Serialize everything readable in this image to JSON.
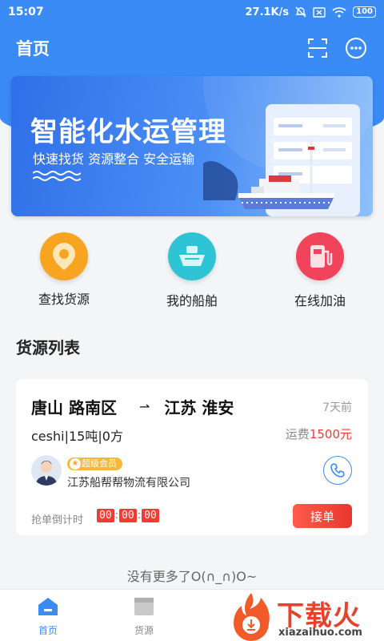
{
  "status_bar": {
    "time": "15:07",
    "network_speed": "27.1K/s",
    "battery": "100"
  },
  "header": {
    "title": "首页",
    "scan_icon": "scan-icon",
    "more_icon": "more-icon"
  },
  "banner": {
    "title": "智能化水运管理",
    "subtitle": "快速找货 资源整合 安全运输"
  },
  "quick_menu": [
    {
      "label": "查找货源",
      "icon": "location-pin-icon",
      "color": "#f7a520"
    },
    {
      "label": "我的船舶",
      "icon": "ship-icon",
      "color": "#2fc3d6"
    },
    {
      "label": "在线加油",
      "icon": "fuel-pump-icon",
      "color": "#f2435c"
    }
  ],
  "section": {
    "title": "货源列表"
  },
  "cargo_list": [
    {
      "origin": "唐山 路南区",
      "destination": "江苏 淮安",
      "time_ago": "7天前",
      "cargo": "ceshi|15吨|0方",
      "freight_label": "运费",
      "freight_amount": "1500元",
      "member_badge": "超级会员",
      "company": "江苏船帮帮物流有限公司",
      "countdown_label": "抢单倒计时",
      "countdown": [
        "00",
        "00",
        "00"
      ],
      "action": "接单"
    }
  ],
  "footer": {
    "no_more": "没有更多了O(∩_∩)O~"
  },
  "tabbar": {
    "items": [
      {
        "label": "首页",
        "active": true
      },
      {
        "label": "货源",
        "active": false
      }
    ]
  },
  "watermark": {
    "text": "下载火",
    "url": "xiazaihuo.com"
  },
  "colors": {
    "primary": "#3a8bf6",
    "accent_red": "#f23c32"
  }
}
